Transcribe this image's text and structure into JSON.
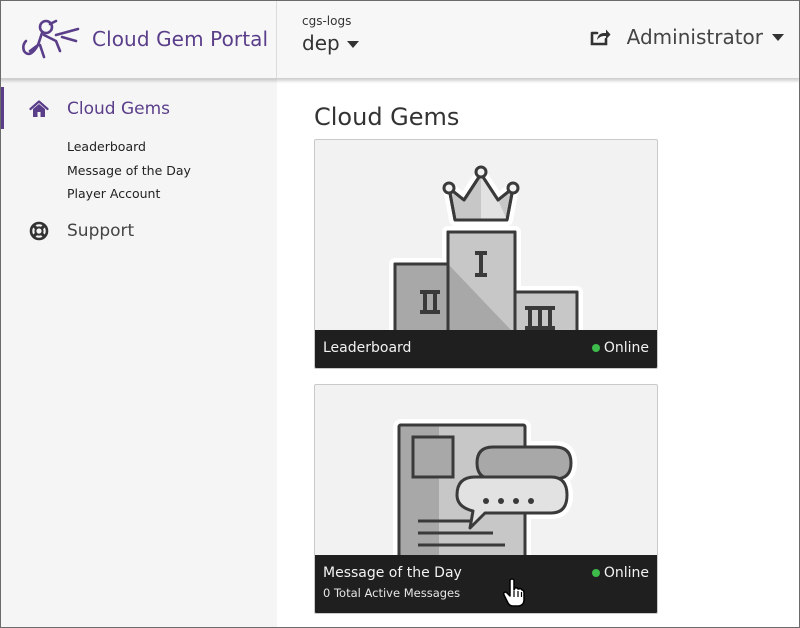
{
  "header": {
    "app_title": "Cloud Gem Portal",
    "project_name": "cgs-logs",
    "deployment": "dep",
    "user": "Administrator",
    "logo_icon": "monkey-logo-icon",
    "share_icon": "share-icon"
  },
  "sidebar": {
    "items": [
      {
        "label": "Cloud Gems",
        "icon": "home-icon",
        "active": true
      },
      {
        "label": "Support",
        "icon": "lifebuoy-icon",
        "active": false
      }
    ],
    "subitems": [
      "Leaderboard",
      "Message of the Day",
      "Player Account"
    ]
  },
  "main": {
    "title": "Cloud Gems",
    "gems": [
      {
        "name": "Leaderboard",
        "status": "Online",
        "subtitle": "",
        "icon": "podium-icon"
      },
      {
        "name": "Message of the Day",
        "status": "Online",
        "subtitle": "0 Total Active Messages",
        "icon": "message-board-icon"
      }
    ]
  },
  "colors": {
    "brand": "#5a3e8a",
    "online": "#3dbb4b",
    "footer_bg": "#1f1f1f"
  }
}
